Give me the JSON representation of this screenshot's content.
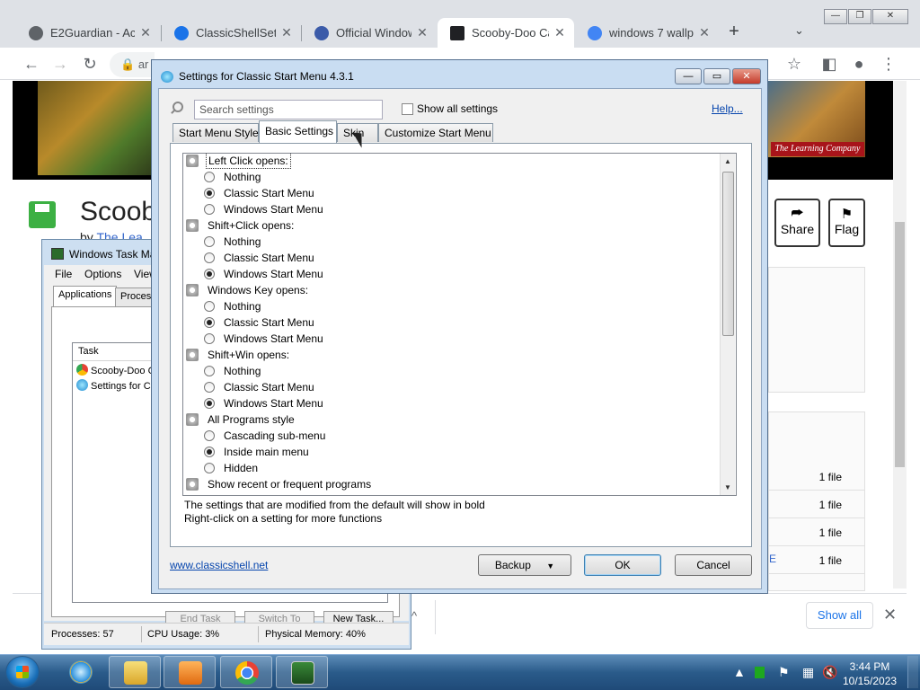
{
  "browser": {
    "tabs": [
      {
        "label": "E2Guardian - Acc",
        "icon_color": "#5f6368"
      },
      {
        "label": "ClassicShellSetup",
        "icon_color": "#1a73e8"
      },
      {
        "label": "Official Windows",
        "icon_color": "#3b5ba9"
      },
      {
        "label": "Scooby-Doo Cas",
        "icon_color": "#202124"
      },
      {
        "label": "windows 7 wallp",
        "icon_color": "#4285f4"
      }
    ],
    "omnibox_text": "ar",
    "icons": [
      "back-icon",
      "forward-icon",
      "reload-icon",
      "lock-icon",
      "star-icon",
      "sidepanel-icon",
      "profile-icon",
      "menu-icon"
    ]
  },
  "page": {
    "title": "Scoob",
    "byline_prefix": "by",
    "byline_link": "The Lea",
    "learning_company": "The Learning Company",
    "share_label": "Share",
    "flag_label": "Flag",
    "file_rows": [
      "1 file",
      "1 file",
      "1 file",
      "1 file"
    ],
    "e_fragment": "E"
  },
  "download_bar": {
    "show_all_label": "Show all",
    "chevron": "^"
  },
  "taskmgr": {
    "title": "Windows Task Ma",
    "menu": [
      "File",
      "Options",
      "View"
    ],
    "tabs": [
      "Applications",
      "Proces"
    ],
    "column_task": "Task",
    "rows": [
      {
        "label": "Scooby-Doo C",
        "icon_color": "#e94235"
      },
      {
        "label": "Settings for Cl",
        "icon_color": "#29a3dd"
      }
    ],
    "buttons": [
      "End Task",
      "Switch To",
      "New Task..."
    ],
    "status": {
      "processes": "Processes: 57",
      "cpu": "CPU Usage: 3%",
      "memory": "Physical Memory: 40%"
    }
  },
  "settings": {
    "title": "Settings for Classic Start Menu 4.3.1",
    "search_placeholder": "Search settings",
    "show_all_label": "Show all settings",
    "help_label": "Help...",
    "tabs": [
      "Start Menu Style",
      "Basic Settings",
      "Skin",
      "Customize Start Menu"
    ],
    "active_tab": "Basic Settings",
    "tree": [
      {
        "type": "cat",
        "label": "Left Click opens:"
      },
      {
        "type": "opt",
        "label": "Nothing",
        "checked": false
      },
      {
        "type": "opt",
        "label": "Classic Start Menu",
        "checked": true
      },
      {
        "type": "opt",
        "label": "Windows Start Menu",
        "checked": false
      },
      {
        "type": "cat",
        "label": "Shift+Click opens:"
      },
      {
        "type": "opt",
        "label": "Nothing",
        "checked": false
      },
      {
        "type": "opt",
        "label": "Classic Start Menu",
        "checked": false
      },
      {
        "type": "opt",
        "label": "Windows Start Menu",
        "checked": true
      },
      {
        "type": "cat",
        "label": "Windows Key opens:"
      },
      {
        "type": "opt",
        "label": "Nothing",
        "checked": false
      },
      {
        "type": "opt",
        "label": "Classic Start Menu",
        "checked": true
      },
      {
        "type": "opt",
        "label": "Windows Start Menu",
        "checked": false
      },
      {
        "type": "cat",
        "label": "Shift+Win opens:"
      },
      {
        "type": "opt",
        "label": "Nothing",
        "checked": false
      },
      {
        "type": "opt",
        "label": "Classic Start Menu",
        "checked": false
      },
      {
        "type": "opt",
        "label": "Windows Start Menu",
        "checked": true
      },
      {
        "type": "cat",
        "label": "All Programs style"
      },
      {
        "type": "opt",
        "label": "Cascading sub-menu",
        "checked": false
      },
      {
        "type": "opt",
        "label": "Inside main menu",
        "checked": true
      },
      {
        "type": "opt",
        "label": "Hidden",
        "checked": false
      },
      {
        "type": "cat",
        "label": "Show recent or frequent programs"
      }
    ],
    "note1": "The settings that are modified from the default will show in bold",
    "note2": "Right-click on a setting for more functions",
    "link": "www.classicshell.net",
    "backup_label": "Backup",
    "ok_label": "OK",
    "cancel_label": "Cancel"
  },
  "taskbar": {
    "apps": [
      {
        "name": "internet-explorer",
        "color": "#2a8fdc",
        "running": false
      },
      {
        "name": "windows-explorer",
        "color": "#e8c04a",
        "running": true
      },
      {
        "name": "media-player",
        "color": "#f07a1a",
        "running": true
      },
      {
        "name": "chrome",
        "color": "#e94235",
        "running": true
      },
      {
        "name": "task-manager",
        "color": "#2b6b2b",
        "running": true
      }
    ],
    "clock_time": "3:44 PM",
    "clock_date": "10/15/2023"
  }
}
